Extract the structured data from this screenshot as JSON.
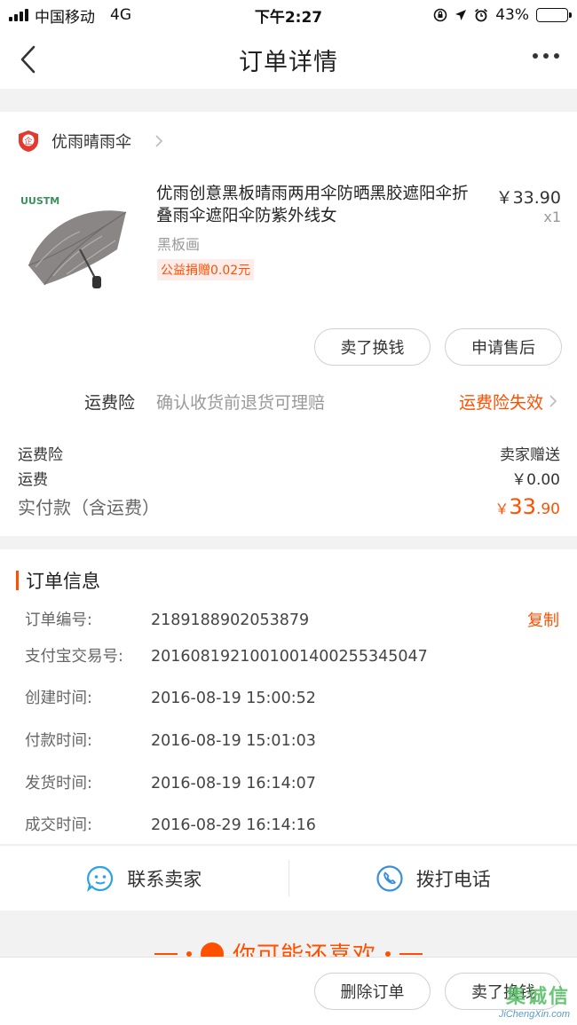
{
  "status_bar": {
    "carrier": "中国移动",
    "network": "4G",
    "time": "下午2:27",
    "battery_text": "43%",
    "battery_level": 0.43
  },
  "nav": {
    "title": "订单详情",
    "back_icon": "chevron-left-icon",
    "more_icon": "more-dots-icon"
  },
  "shop": {
    "name": "优雨晴雨伞"
  },
  "product": {
    "brand_mark": "UUSTM",
    "title": "优雨创意黑板晴雨两用伞防晒黑胶遮阳伞折叠雨伞遮阳伞防紫外线女",
    "price": "￥33.90",
    "quantity": "x1",
    "sku": "黑板画",
    "donation_tag": "公益捐赠0.02元"
  },
  "actions": {
    "sell_label": "卖了换钱",
    "after_sale_label": "申请售后"
  },
  "insurance": {
    "label": "运费险",
    "description": "确认收货前退货可理赔",
    "status": "运费险失效"
  },
  "fees": {
    "insurance_label": "运费险",
    "insurance_value": "卖家赠送",
    "shipping_label": "运费",
    "shipping_value": "￥0.00",
    "total_label": "实付款（含运费）",
    "total_currency": "￥",
    "total_integer": "33",
    "total_decimal": ".90"
  },
  "order_info": {
    "title": "订单信息",
    "copy_label": "复制",
    "rows": [
      {
        "label": "订单编号:",
        "value": "2189188902053879"
      },
      {
        "label": "支付宝交易号:",
        "value": "2016081921001001400255345047"
      },
      {
        "label": "创建时间:",
        "value": "2016-08-19 15:00:52"
      },
      {
        "label": "付款时间:",
        "value": "2016-08-19 15:01:03"
      },
      {
        "label": "发货时间:",
        "value": "2016-08-19 16:14:07"
      },
      {
        "label": "成交时间:",
        "value": "2016-08-29 16:14:16"
      }
    ]
  },
  "contact": {
    "chat_label": "联系卖家",
    "phone_label": "拨打电话"
  },
  "recommend": {
    "title": "你可能还喜欢"
  },
  "bottom": {
    "delete_label": "删除订单",
    "sell_label": "卖了换钱"
  },
  "watermark": {
    "line1": "集诚信",
    "line2": "JiChengXin.com"
  },
  "colors": {
    "accent": "#ff5000",
    "chat_icon": "#29a3e6",
    "phone_icon": "#3a8fd8"
  }
}
